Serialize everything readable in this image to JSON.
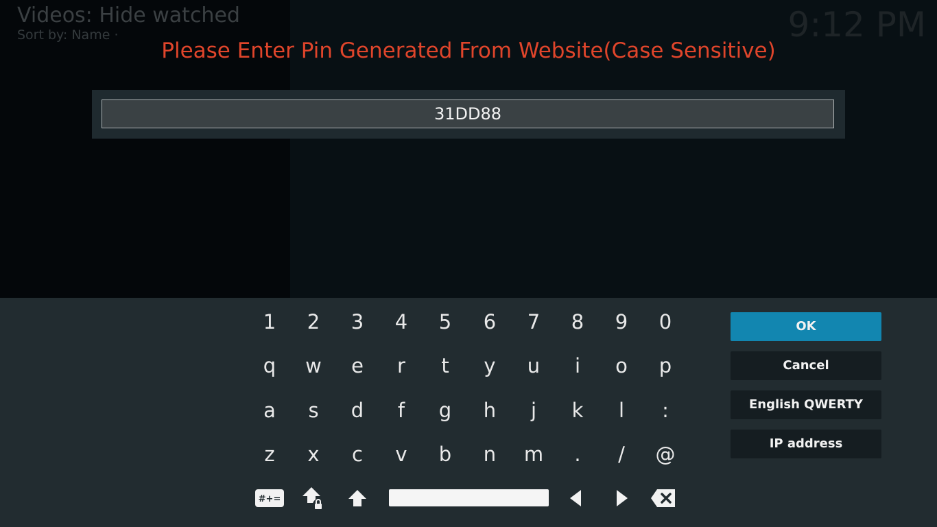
{
  "header": {
    "title": "Videos: Hide watched",
    "sort": "Sort by: Name  ·",
    "clock": "9:12 PM"
  },
  "dialog": {
    "heading": "Please Enter Pin Generated From Website(Case Sensitive)",
    "input_value": "31DD88"
  },
  "keyboard": {
    "rows": [
      [
        "1",
        "2",
        "3",
        "4",
        "5",
        "6",
        "7",
        "8",
        "9",
        "0"
      ],
      [
        "q",
        "w",
        "e",
        "r",
        "t",
        "y",
        "u",
        "i",
        "o",
        "p"
      ],
      [
        "a",
        "s",
        "d",
        "f",
        "g",
        "h",
        "j",
        "k",
        "l",
        ":"
      ],
      [
        "z",
        "x",
        "c",
        "v",
        "b",
        "n",
        "m",
        ".",
        "/",
        "@"
      ]
    ],
    "symbols_label": "#+=",
    "controls": [
      "symbols-icon",
      "caps-lock-icon",
      "shift-icon",
      "space-bar",
      "left-arrow-icon",
      "right-arrow-icon",
      "backspace-icon"
    ]
  },
  "buttons": {
    "ok": "OK",
    "cancel": "Cancel",
    "layout": "English QWERTY",
    "ip": "IP address"
  },
  "colors": {
    "accent": "#1286b0",
    "heading": "#e0452b",
    "keyboard_bg": "#222c30",
    "button_bg": "#151d21"
  }
}
